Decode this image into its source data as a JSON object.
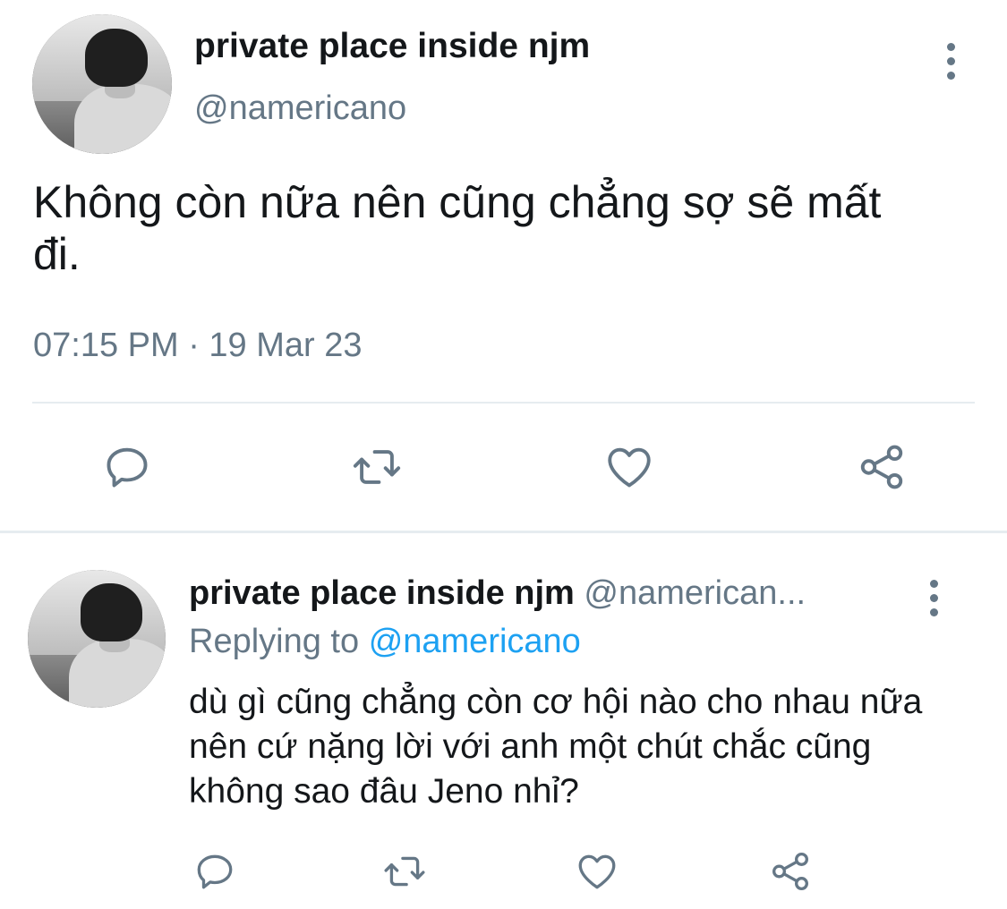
{
  "tweet": {
    "author_name": "private place inside njm",
    "author_handle": "@namericano",
    "text": "Không còn nữa nên cũng chẳng sợ sẽ mất đi.",
    "timestamp": "07:15 PM · 19 Mar 23",
    "actions": [
      "reply-icon",
      "retweet-icon",
      "like-icon",
      "share-icon"
    ]
  },
  "reply": {
    "author_name": "private place inside njm",
    "author_handle": "@namerican...",
    "replying_label": "Replying to",
    "replying_to": "@namericano",
    "text": "dù gì cũng chẳng còn cơ hội nào cho nhau nữa nên cứ nặng lời với anh một chút chắc cũng không sao đâu Jeno nhỉ?",
    "actions": [
      "reply-icon",
      "retweet-icon",
      "like-icon",
      "share-icon"
    ]
  },
  "colors": {
    "text": "#14171a",
    "muted": "#657786",
    "link": "#1da1f2",
    "divider": "#e6ecf0"
  }
}
